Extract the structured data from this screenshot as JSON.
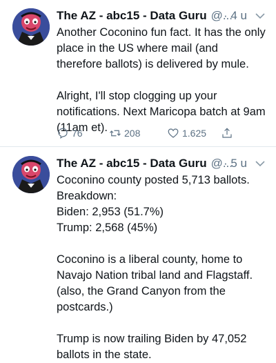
{
  "tweets": [
    {
      "author": "The AZ - abc15 - Data Guru",
      "handle": "@...",
      "time": "· 4 u",
      "text": "Another Coconino fun fact. It has the only place in the US where mail (and therefore ballots) is delivered by mule.\n\nAlright, I'll stop clogging up your notifications. Next Maricopa batch at 9am (11am et).",
      "replies": "76",
      "retweets": "208",
      "likes": "1.625"
    },
    {
      "author": "The AZ - abc15 - Data Guru",
      "handle": "@...",
      "time": "· 5 u",
      "text": "Coconino county posted 5,713 ballots.\nBreakdown:\nBiden: 2,953 (51.7%)\nTrump: 2,568 (45%)\n\nCoconino is a liberal county, home to Navajo Nation tribal land and Flagstaff. (also, the Grand Canyon from the postcards.)\n\nTrump is now trailing Biden by 47,052 ballots in the state."
    }
  ],
  "icons": {
    "reply": "reply-icon",
    "retweet": "retweet-icon",
    "like": "like-icon",
    "share": "share-icon",
    "more": "chevron-down-icon"
  },
  "colors": {
    "text": "#0f1419",
    "secondary": "#5b7083",
    "divider": "#e1e8ed"
  }
}
